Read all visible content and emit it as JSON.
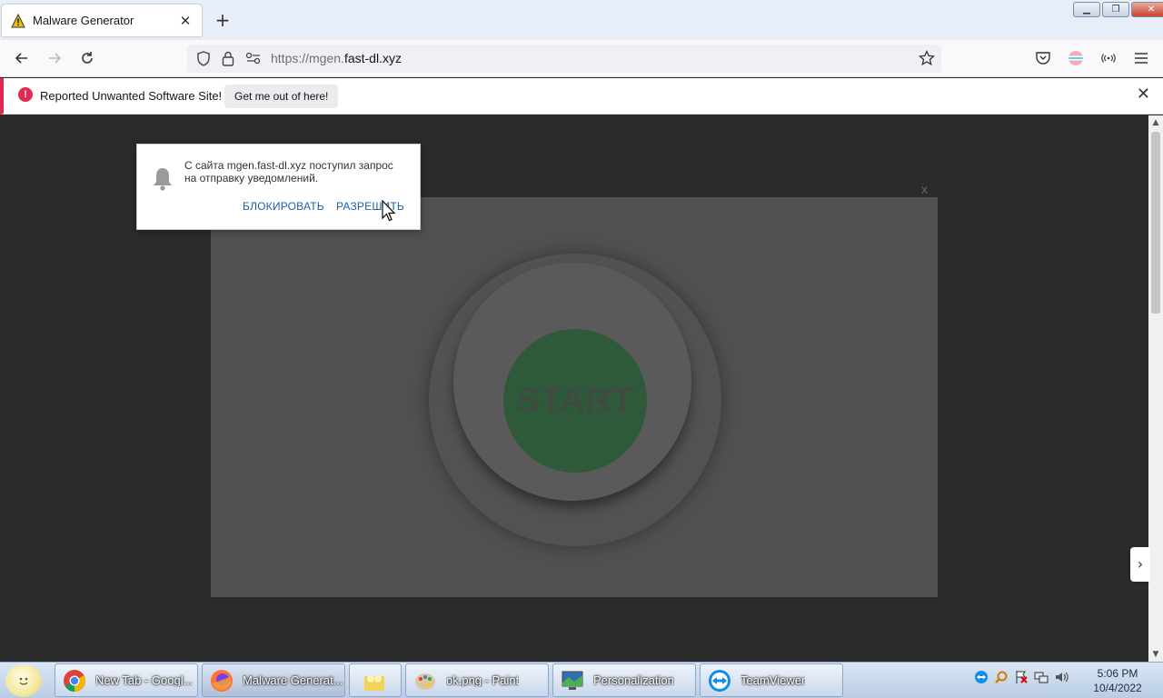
{
  "browser": {
    "tab": {
      "title": "Malware Generator",
      "close": "✕"
    },
    "new_tab": "+",
    "window_controls": {
      "minimize": "▁",
      "restore": "❐",
      "close": "✕"
    },
    "url": {
      "scheme": "https://mgen.",
      "host": "fast-dl.xyz"
    }
  },
  "warning_bar": {
    "alert": "!",
    "message": "Reported Unwanted Software Site!",
    "button": "Get me out of here!",
    "close": "✕"
  },
  "permission_popup": {
    "line1": "С сайта mgen.fast-dl.xyz поступил запрос",
    "line2": "на отправку уведомлений.",
    "block": "БЛОКИРОВАТЬ",
    "allow": "РАЗРЕШИТЬ"
  },
  "page": {
    "modal_close": "x",
    "start_label": "START",
    "side_arrow": "›"
  },
  "taskbar": {
    "items": [
      {
        "label": "New Tab - Googl..."
      },
      {
        "label": "Malware Generat..."
      },
      {
        "label": ""
      },
      {
        "label": "ok.png - Paint"
      },
      {
        "label": "Personalization"
      },
      {
        "label": "TeamViewer"
      }
    ],
    "clock": {
      "time": "5:06 PM",
      "date": "10/4/2022"
    }
  },
  "colors": {
    "warning_red": "#e22850",
    "popup_link": "#1a5fa8",
    "start_green": "#2e5a3a",
    "page_bg": "#2b2b2b"
  }
}
